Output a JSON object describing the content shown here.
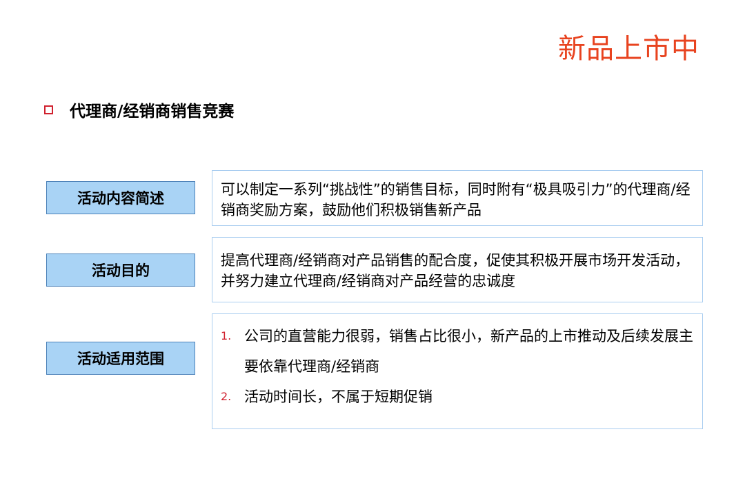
{
  "slide": {
    "corner_title": "新品上市中",
    "heading": "代理商/经销商销售竞赛"
  },
  "rows": [
    {
      "label": "活动内容简述",
      "text": "可以制定一系列“挑战性”的销售目标，同时附有“极具吸引力”的代理商/经销商奖励方案，鼓励他们积极销售新产品"
    },
    {
      "label": "活动目的",
      "text": "提高代理商/经销商对产品销售的配合度，促使其积极开展市场开发活动，并努力建立代理商/经销商对产品经营的忠诚度"
    },
    {
      "label": "活动适用范围",
      "items": [
        {
          "num": "1.",
          "text": "公司的直营能力很弱，销售占比很小，新产品的上市推动及后续发展主要依靠代理商/经销商"
        },
        {
          "num": "2.",
          "text": "活动时间长，不属于短期促销"
        }
      ]
    }
  ],
  "colors": {
    "accent_red": "#e8431f",
    "label_fill": "#a9d3f5",
    "label_border": "#4a80b8",
    "content_border": "#a9cdf0",
    "bullet_red": "#d0202e"
  }
}
